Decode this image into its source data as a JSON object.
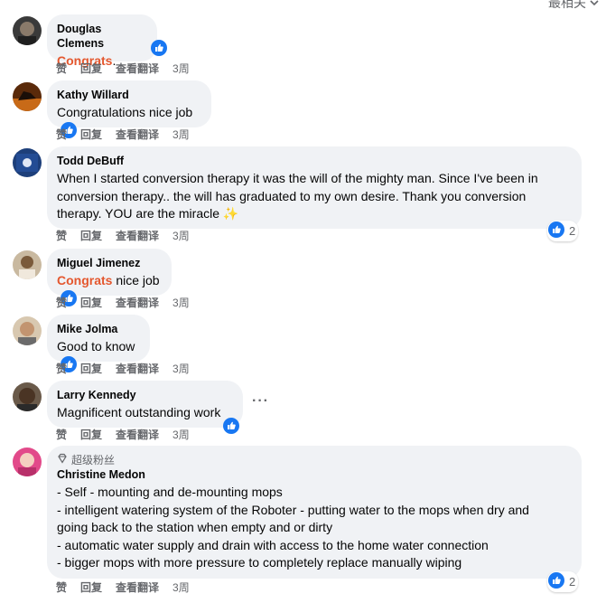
{
  "header": {
    "sort_label": "最相关"
  },
  "comments": [
    {
      "author": "Douglas Clemens",
      "highlight": "Congrats",
      "text": ".",
      "actions": [
        "赞",
        "回复",
        "查看翻译"
      ],
      "time": "3周"
    },
    {
      "author": "Kathy Willard",
      "text": "Congratulations nice job",
      "actions": [
        "赞",
        "回复",
        "查看翻译"
      ],
      "time": "3周"
    },
    {
      "author": "Todd DeBuff",
      "lines": [
        "When I started conversion therapy it was the will of the mighty man. Since I've been in",
        "conversion therapy.. the will has graduated to my own desire. Thank you conversion",
        "therapy. YOU are the miracle ✨"
      ],
      "reaction_count": "2",
      "actions": [
        "赞",
        "回复",
        "查看翻译"
      ],
      "time": "3周"
    },
    {
      "author": "Miguel Jimenez",
      "highlight": "Congrats",
      "text": " nice job",
      "actions": [
        "赞",
        "回复",
        "查看翻译"
      ],
      "time": "3周"
    },
    {
      "author": "Mike Jolma",
      "text": "Good to know",
      "actions": [
        "赞",
        "回复",
        "查看翻译"
      ],
      "time": "3周"
    },
    {
      "author": "Larry Kennedy",
      "text": "Magnificent outstanding work",
      "more": "···",
      "actions": [
        "赞",
        "回复",
        "查看翻译"
      ],
      "time": "3周"
    },
    {
      "badge": "超级粉丝",
      "author": "Christine Medon",
      "lines": [
        "- Self - mounting and de-mounting mops",
        "- intelligent watering system of the Roboter - putting water to the mops when dry and",
        "going back to the station when empty and or dirty",
        "- automatic water supply and drain with access to the home water connection",
        "- bigger mops with more pressure to completely replace manually wiping"
      ],
      "reaction_count": "2",
      "actions": [
        "赞",
        "回复",
        "查看翻译"
      ],
      "time": "3周"
    }
  ],
  "colors": {
    "bubble": "#f0f2f5",
    "like_blue": "#1877f2",
    "highlight": "#e4572e",
    "secondary_text": "#65676b"
  },
  "icons": {
    "like": "thumbs-up-icon",
    "badge": "diamond-icon",
    "sort": "chevron-down-icon"
  }
}
